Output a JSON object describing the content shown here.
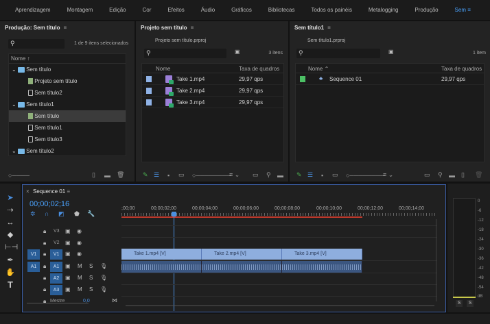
{
  "menu": {
    "items": [
      "Aprendizagem",
      "Montagem",
      "Edição",
      "Cor",
      "Efeitos",
      "Áudio",
      "Gráficos",
      "Bibliotecas",
      "Todos os painéis",
      "Metalogging",
      "Produção"
    ],
    "active": "Sem",
    "menu_icon": "≡"
  },
  "production": {
    "title": "Produção: Sem título",
    "status": "1 de 9 itens selecionados",
    "column": "Nome",
    "tree": [
      {
        "label": "Sem título",
        "type": "folder"
      },
      {
        "label": "Projeto sem título",
        "type": "project"
      },
      {
        "label": "Sem título2",
        "type": "doc"
      },
      {
        "label": "Sem título1",
        "type": "folder"
      },
      {
        "label": "Sem título",
        "type": "project",
        "selected": true
      },
      {
        "label": "Sem título1",
        "type": "doc"
      },
      {
        "label": "Sem título3",
        "type": "doc"
      },
      {
        "label": "Sem título2",
        "type": "folder"
      }
    ]
  },
  "project1": {
    "title": "Projeto sem título",
    "file": "Projeto sem título.prproj",
    "count": "3 itens",
    "col_name": "Nome",
    "col_rate": "Taxa de quadros",
    "rows": [
      {
        "name": "Take 1.mp4",
        "rate": "29,97 qps"
      },
      {
        "name": "Take 2.mp4",
        "rate": "29,97 qps"
      },
      {
        "name": "Take 3.mp4",
        "rate": "29,97 qps"
      }
    ]
  },
  "project2": {
    "title": "Sem título1",
    "file": "Sem título1.prproj",
    "count": "1 item",
    "col_name": "Nome",
    "col_rate": "Taxa de quadros",
    "rows": [
      {
        "name": "Sequence 01",
        "rate": "29,97 qps"
      }
    ]
  },
  "sequence": {
    "tab": "Sequence 01",
    "timecode": "00;00;02;16",
    "playhead_seconds": 2.53,
    "ruler": [
      ";00;00",
      "00;00;02;00",
      "00;00;04;00",
      "00;00;06;00",
      "00;00;08;00",
      "00;00;10;00",
      "00;00;12;00",
      "00;00;14;00"
    ],
    "video_tracks": [
      "V3",
      "V2",
      "V1"
    ],
    "audio_tracks": [
      "A1",
      "A2",
      "A3"
    ],
    "source_v": "V1",
    "source_a": "A1",
    "master": "Mestre",
    "master_value": "0,0",
    "clips_video": [
      "Take 1.mp4 [V]",
      "Take 2.mp4 [V]",
      "Take 3.mp4 [V]"
    ],
    "mute": "M",
    "solo": "S"
  },
  "meter": {
    "scale": [
      "0",
      "-6",
      "-12",
      "-18",
      "-24",
      "-30",
      "-36",
      "-42",
      "-48",
      "-54",
      "dB"
    ],
    "solo_left": "S",
    "solo_right": "S"
  }
}
